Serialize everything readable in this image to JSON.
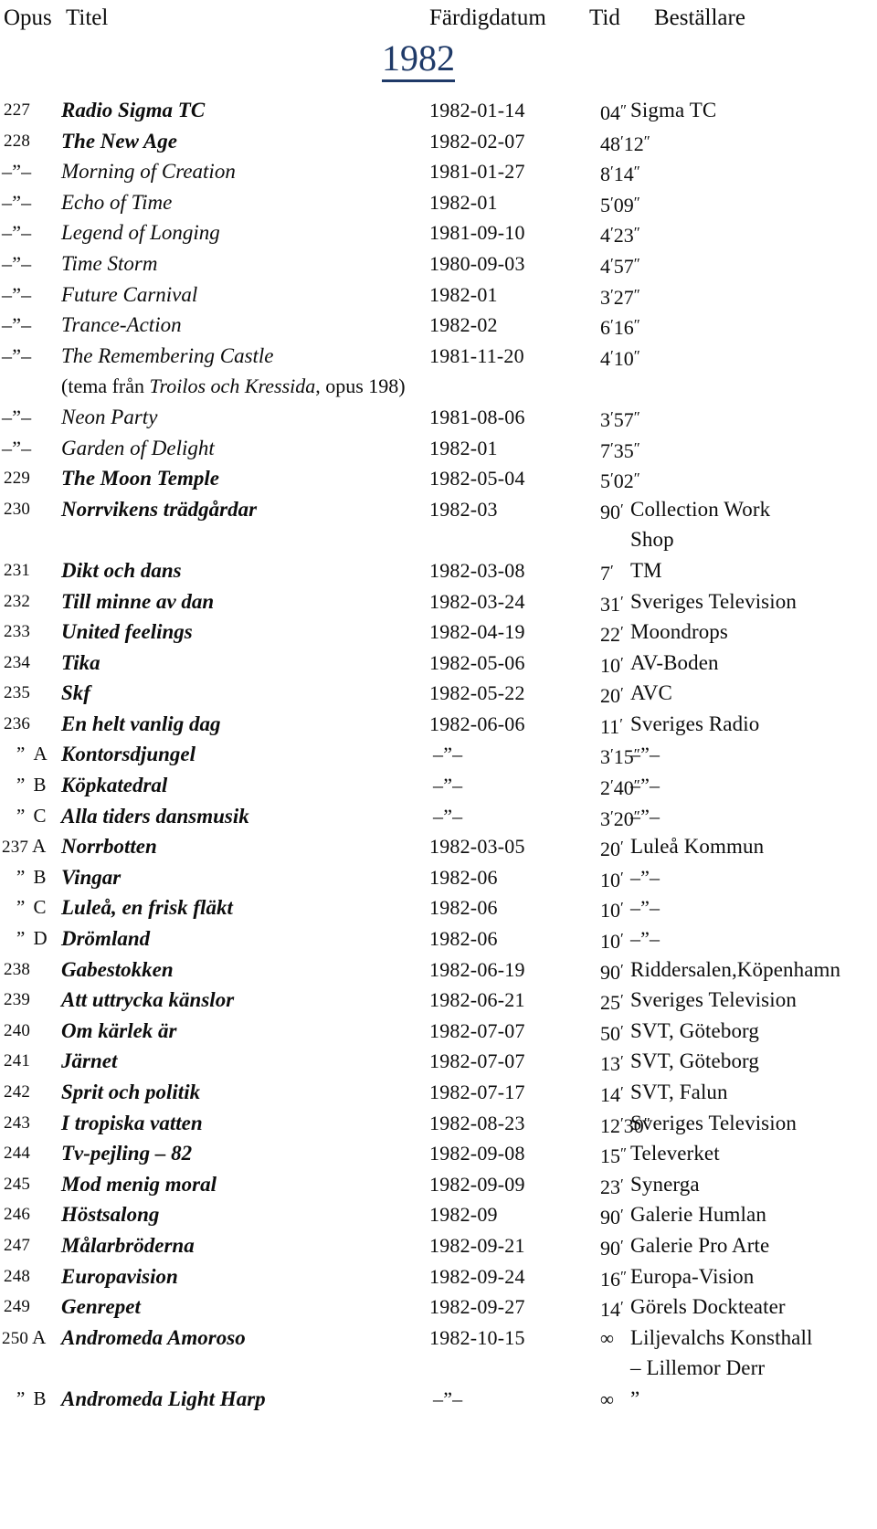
{
  "header": {
    "opus": "Opus",
    "titel": "Titel",
    "fardigdatum": "Färdigdatum",
    "tid": "Tid",
    "bestallare": "Beställare"
  },
  "year_heading": "1982",
  "accent_color": "#1f3a68",
  "ditto_mark": "–”–",
  "ditto_quote": "”",
  "infinity": "∞",
  "rows": [
    {
      "opus": "227",
      "style": "main",
      "title": "Radio Sigma TC",
      "date": "1982-01-14",
      "tid": "04″",
      "best": "Sigma TC"
    },
    {
      "opus": "228",
      "style": "main",
      "title": "The New Age",
      "date": "1982-02-07",
      "tid": "48′12″",
      "best": ""
    },
    {
      "opus": "–”–",
      "style": "cont",
      "title": "Morning of Creation",
      "date": "1981-01-27",
      "tid": "8′14″",
      "best": ""
    },
    {
      "opus": "–”–",
      "style": "cont",
      "title": "Echo of Time",
      "date": "1982-01",
      "tid": "5′09″",
      "best": ""
    },
    {
      "opus": "–”–",
      "style": "cont",
      "title": "Legend of Longing",
      "date": "1981-09-10",
      "tid": "4′23″",
      "best": ""
    },
    {
      "opus": "–”–",
      "style": "cont",
      "title": "Time Storm",
      "date": "1980-09-03",
      "tid": "4′57″",
      "best": ""
    },
    {
      "opus": "–”–",
      "style": "cont",
      "title": "Future Carnival",
      "date": "1982-01",
      "tid": "3′27″",
      "best": ""
    },
    {
      "opus": "–”–",
      "style": "cont",
      "title": "Trance-Action",
      "date": "1982-02",
      "tid": "6′16″",
      "best": ""
    },
    {
      "opus": "–”–",
      "style": "cont",
      "title": "The Remembering Castle",
      "date": "1981-11-20",
      "tid": "4′10″",
      "best": ""
    },
    {
      "opus": "",
      "style": "note",
      "title_pre": "(tema från ",
      "title_em": "Troilos och Kressida",
      "title_post": ", opus 198)",
      "date": "",
      "tid": "",
      "best": ""
    },
    {
      "opus": "–”–",
      "style": "cont",
      "title": "Neon Party",
      "date": "1981-08-06",
      "tid": "3′57″",
      "best": ""
    },
    {
      "opus": "–”–",
      "style": "cont",
      "title": "Garden of Delight",
      "date": "1982-01",
      "tid": "7′35″",
      "best": ""
    },
    {
      "opus": "229",
      "style": "main",
      "title": "The Moon Temple",
      "date": "1982-05-04",
      "tid": "5′02″",
      "best": ""
    },
    {
      "opus": "230",
      "style": "main",
      "title": "Norrvikens trädgårdar",
      "date": "1982-03",
      "tid": "90′",
      "best": "Collection Work"
    },
    {
      "opus": "",
      "style": "contline",
      "date": "",
      "tid": "",
      "best": "Shop"
    },
    {
      "opus": "231",
      "style": "main",
      "title": "Dikt och dans",
      "date": "1982-03-08",
      "tid": "7′",
      "best": "TM"
    },
    {
      "opus": "232",
      "style": "main",
      "title": "Till minne av dan",
      "date": "1982-03-24",
      "tid": "31′",
      "best": "Sveriges Television"
    },
    {
      "opus": "233",
      "style": "main",
      "title": "United feelings",
      "date": "1982-04-19",
      "tid": "22′",
      "best": "Moondrops"
    },
    {
      "opus": "234",
      "style": "main",
      "title": "Tika",
      "date": "1982-05-06",
      "tid": "10′",
      "best": "AV-Boden"
    },
    {
      "opus": "235",
      "style": "main",
      "title": "Skf",
      "date": "1982-05-22",
      "tid": "20′",
      "best": "AVC"
    },
    {
      "opus": "236",
      "style": "main",
      "title": "En helt vanlig dag",
      "date": "1982-06-06",
      "tid": "11′",
      "best": "Sveriges Radio"
    },
    {
      "opus": "”",
      "letter": "A",
      "style": "sub",
      "title": "Kontorsdjungel",
      "date": "–”–",
      "tid": "3′15″",
      "best": "–”–"
    },
    {
      "opus": "”",
      "letter": "B",
      "style": "sub",
      "title": "Köpkatedral",
      "date": "–”–",
      "tid": "2′40″",
      "best": "–”–"
    },
    {
      "opus": "”",
      "letter": "C",
      "style": "sub",
      "title": "Alla tiders dansmusik",
      "date": "–”–",
      "tid": "3′20″",
      "best": "–”–"
    },
    {
      "opus": "237",
      "letter": "A",
      "style": "numsub",
      "title": "Norrbotten",
      "date": "1982-03-05",
      "tid": "20′",
      "best": "Luleå Kommun"
    },
    {
      "opus": "”",
      "letter": "B",
      "style": "sub",
      "title": "Vingar",
      "date": "1982-06",
      "tid": "10′",
      "best": "–”–"
    },
    {
      "opus": "”",
      "letter": "C",
      "style": "sub",
      "title": "Luleå, en frisk fläkt",
      "date": "1982-06",
      "tid": "10′",
      "best": "–”–"
    },
    {
      "opus": "”",
      "letter": "D",
      "style": "sub",
      "title": "Drömland",
      "date": "1982-06",
      "tid": "10′",
      "best": "–”–"
    },
    {
      "opus": "238",
      "style": "main",
      "title": "Gabestokken",
      "date": "1982-06-19",
      "tid": "90′",
      "best": "Riddersalen,Köpenhamn"
    },
    {
      "opus": "239",
      "style": "main",
      "title": "Att uttrycka känslor",
      "date": "1982-06-21",
      "tid": "25′",
      "best": "Sveriges Television"
    },
    {
      "opus": "240",
      "style": "main",
      "title": "Om kärlek är",
      "date": "1982-07-07",
      "tid": "50′",
      "best": "SVT, Göteborg"
    },
    {
      "opus": "241",
      "style": "main",
      "title": "Järnet",
      "date": "1982-07-07",
      "tid": "13′",
      "best": "SVT, Göteborg"
    },
    {
      "opus": "242",
      "style": "main",
      "title": "Sprit och politik",
      "date": "1982-07-17",
      "tid": "14′",
      "best": "SVT, Falun"
    },
    {
      "opus": "243",
      "style": "main",
      "title": "I tropiska vatten",
      "date": "1982-08-23",
      "tid": "12′30″",
      "best": "Sveriges Television"
    },
    {
      "opus": "244",
      "style": "main",
      "title": "Tv-pejling – 82",
      "date": "1982-09-08",
      "tid": "15″",
      "best": "Televerket"
    },
    {
      "opus": "245",
      "style": "main",
      "title": "Mod menig moral",
      "date": "1982-09-09",
      "tid": "23′",
      "best": "Synerga"
    },
    {
      "opus": "246",
      "style": "main",
      "title": "Höstsalong",
      "date": "1982-09",
      "tid": "90′",
      "best": "Galerie Humlan"
    },
    {
      "opus": "247",
      "style": "main",
      "title": "Målarbröderna",
      "date": "1982-09-21",
      "tid": "90′",
      "best": "Galerie Pro Arte"
    },
    {
      "opus": "248",
      "style": "main",
      "title": "Europavision",
      "date": "1982-09-24",
      "tid": "16″",
      "best": "Europa-Vision"
    },
    {
      "opus": "249",
      "style": "main",
      "title": "Genrepet",
      "date": "1982-09-27",
      "tid": "14′",
      "best": "Görels Dockteater"
    },
    {
      "opus": "250",
      "letter": "A",
      "style": "numsub",
      "title": "Andromeda Amoroso",
      "date": "1982-10-15",
      "tid": "∞",
      "best": "Liljevalchs Konsthall"
    },
    {
      "opus": "",
      "style": "contline",
      "date": "",
      "tid": "",
      "best": "– Lillemor Derr"
    },
    {
      "opus": "”",
      "letter": "B",
      "style": "sub",
      "title": "Andromeda Light Harp",
      "date": "–”–",
      "tid": "∞",
      "best": "”"
    }
  ]
}
